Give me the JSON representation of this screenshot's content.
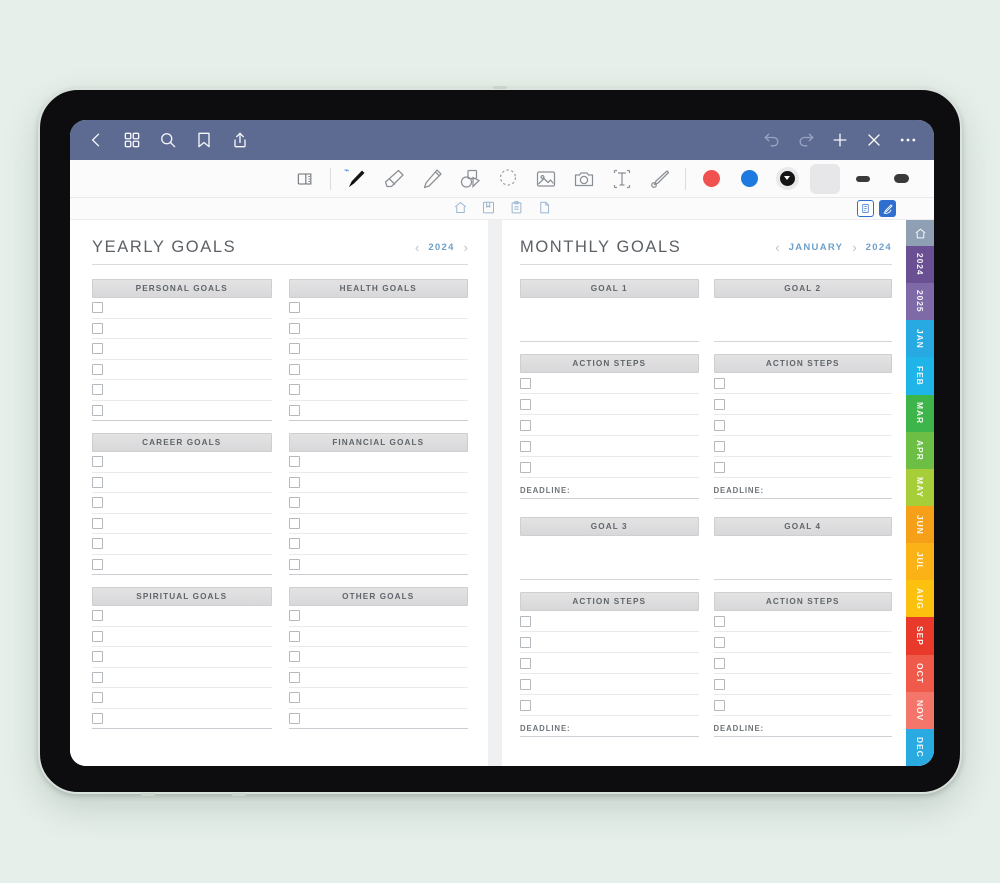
{
  "app": {
    "background_color": "#e6efe9",
    "topbar_color": "#5d6a92",
    "accent_color": "#6fa0c9"
  },
  "topbar": {
    "left_icons": [
      {
        "name": "back-icon",
        "label": "Back"
      },
      {
        "name": "grid-thumbnails-icon",
        "label": "Page thumbnails"
      },
      {
        "name": "search-icon",
        "label": "Search"
      },
      {
        "name": "bookmark-icon",
        "label": "Bookmark"
      },
      {
        "name": "share-icon",
        "label": "Share"
      }
    ],
    "right_icons": [
      {
        "name": "undo-icon",
        "label": "Undo"
      },
      {
        "name": "redo-icon",
        "label": "Redo"
      },
      {
        "name": "add-icon",
        "label": "Add"
      },
      {
        "name": "close-icon",
        "label": "Close"
      },
      {
        "name": "more-icon",
        "label": "More"
      }
    ]
  },
  "toolbar": {
    "tools": [
      {
        "name": "page-flip-icon",
        "label": "Page flip",
        "selected": false
      },
      {
        "name": "pen-icon",
        "label": "Pen",
        "selected": true,
        "bluetooth": true
      },
      {
        "name": "eraser-icon",
        "label": "Eraser",
        "selected": false
      },
      {
        "name": "highlighter-icon",
        "label": "Highlighter",
        "selected": false
      },
      {
        "name": "shapes-icon",
        "label": "Shapes",
        "selected": false
      },
      {
        "name": "lasso-icon",
        "label": "Lasso select",
        "selected": false
      },
      {
        "name": "image-icon",
        "label": "Insert image",
        "selected": false
      },
      {
        "name": "camera-icon",
        "label": "Camera",
        "selected": false
      },
      {
        "name": "text-box-icon",
        "label": "Text box",
        "selected": false
      },
      {
        "name": "sticker-icon",
        "label": "Sticker",
        "selected": false
      }
    ],
    "colors": [
      {
        "name": "color-swatch-red",
        "hex": "#f0534f",
        "selected": false
      },
      {
        "name": "color-swatch-blue",
        "hex": "#1e7ae0",
        "selected": false
      },
      {
        "name": "color-swatch-black",
        "hex": "#141414",
        "selected": true
      }
    ],
    "strokes": [
      {
        "name": "stroke-thin",
        "selected": true
      },
      {
        "name": "stroke-medium",
        "selected": false
      },
      {
        "name": "stroke-thick",
        "selected": false
      }
    ]
  },
  "page_nav": {
    "center_icons": [
      {
        "name": "home-icon",
        "label": "Home"
      },
      {
        "name": "notebook-icon",
        "label": "Notebook"
      },
      {
        "name": "clipboard-icon",
        "label": "Planner"
      },
      {
        "name": "page-icon",
        "label": "Page"
      }
    ],
    "right_chips": [
      {
        "name": "sticker-sheet-chip",
        "label": "Stickers",
        "style": "outline"
      },
      {
        "name": "pen-tool-chip",
        "label": "Pen tool",
        "style": "filled"
      }
    ]
  },
  "left_page": {
    "title": "YEARLY GOALS",
    "nav": {
      "prev": "‹",
      "value": "2024",
      "next": "›"
    },
    "rows_per_section": 6,
    "sections": [
      {
        "name": "personal-goals",
        "title": "PERSONAL GOALS"
      },
      {
        "name": "health-goals",
        "title": "HEALTH GOALS"
      },
      {
        "name": "career-goals",
        "title": "CAREER GOALS"
      },
      {
        "name": "financial-goals",
        "title": "FINANCIAL GOALS"
      },
      {
        "name": "spiritual-goals",
        "title": "SPIRITUAL GOALS"
      },
      {
        "name": "other-goals",
        "title": "OTHER GOALS"
      }
    ]
  },
  "right_page": {
    "title": "MONTHLY GOALS",
    "nav": {
      "prev": "‹",
      "month": "JANUARY",
      "next": "›",
      "year": "2024"
    },
    "action_steps_label": "ACTION STEPS",
    "deadline_label": "DEADLINE:",
    "action_rows": 5,
    "goals": [
      {
        "name": "goal-1",
        "title": "GOAL 1"
      },
      {
        "name": "goal-2",
        "title": "GOAL 2"
      },
      {
        "name": "goal-3",
        "title": "GOAL 3"
      },
      {
        "name": "goal-4",
        "title": "GOAL 4"
      }
    ]
  },
  "rail": {
    "home": {
      "name": "rail-home-icon",
      "color": "#8fa0b4"
    },
    "tabs": [
      {
        "label": "2024",
        "color": "#6b4f93"
      },
      {
        "label": "2025",
        "color": "#7f6aa8"
      },
      {
        "label": "JAN",
        "color": "#27a9e1"
      },
      {
        "label": "FEB",
        "color": "#1fb5e8"
      },
      {
        "label": "MAR",
        "color": "#3db54a"
      },
      {
        "label": "APR",
        "color": "#6cbe45"
      },
      {
        "label": "MAY",
        "color": "#a6ce39"
      },
      {
        "label": "JUN",
        "color": "#f6a01a"
      },
      {
        "label": "JUL",
        "color": "#fbb216"
      },
      {
        "label": "AUG",
        "color": "#fcc10e"
      },
      {
        "label": "SEP",
        "color": "#e8392b"
      },
      {
        "label": "OCT",
        "color": "#ef5a4a"
      },
      {
        "label": "NOV",
        "color": "#f4766a"
      },
      {
        "label": "DEC",
        "color": "#29abe2"
      }
    ]
  }
}
